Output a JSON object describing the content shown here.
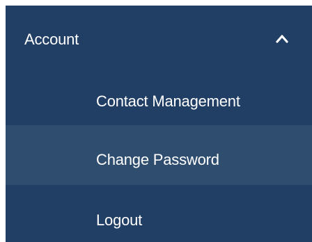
{
  "menu": {
    "header": {
      "label": "Account",
      "icon": "chevron-up-icon",
      "expanded": true
    },
    "items": [
      {
        "label": "Contact Management"
      },
      {
        "label": "Change Password",
        "highlighted": true
      },
      {
        "label": "Logout"
      }
    ]
  },
  "colors": {
    "background": "#213f64",
    "highlight": "#2f4d6f",
    "text": "#ffffff",
    "page": "#ffffff"
  }
}
